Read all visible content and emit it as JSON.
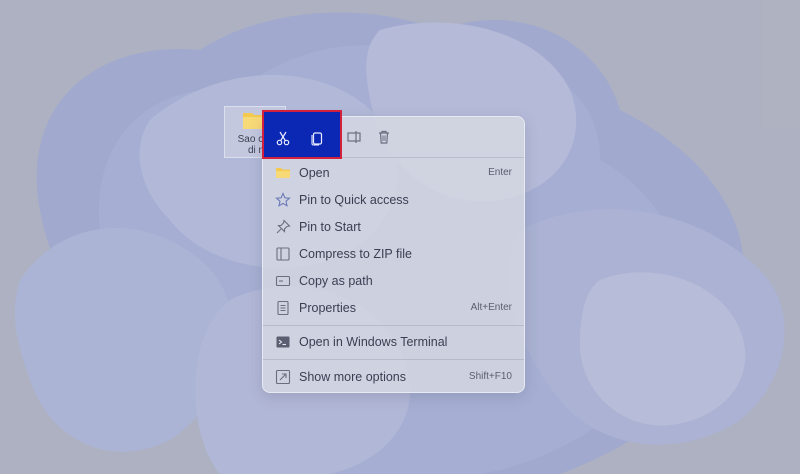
{
  "desktop": {
    "folder_label_line1": "Sao ché",
    "folder_label_line2": "di n"
  },
  "context_menu": {
    "toolbar": [
      "cut-icon",
      "copy-icon",
      "rename-icon",
      "delete-icon"
    ],
    "items": [
      {
        "label": "Open",
        "shortcut": "Enter",
        "icon": "folder-icon"
      },
      {
        "label": "Pin to Quick access",
        "shortcut": "",
        "icon": "star-icon"
      },
      {
        "label": "Pin to Start",
        "shortcut": "",
        "icon": "pin-icon"
      },
      {
        "label": "Compress to ZIP file",
        "shortcut": "",
        "icon": "zip-icon"
      },
      {
        "label": "Copy as path",
        "shortcut": "",
        "icon": "copy-path-icon"
      },
      {
        "label": "Properties",
        "shortcut": "Alt+Enter",
        "icon": "properties-icon"
      },
      {
        "label": "Open in Windows Terminal",
        "shortcut": "",
        "icon": "terminal-icon"
      },
      {
        "label": "Show more options",
        "shortcut": "Shift+F10",
        "icon": "more-options-icon"
      }
    ]
  },
  "colors": {
    "highlight_fill": "#0b28b5",
    "highlight_border": "#d3203c",
    "folder_yellow": "#f3c94e",
    "menu_text": "#3a3e52"
  }
}
